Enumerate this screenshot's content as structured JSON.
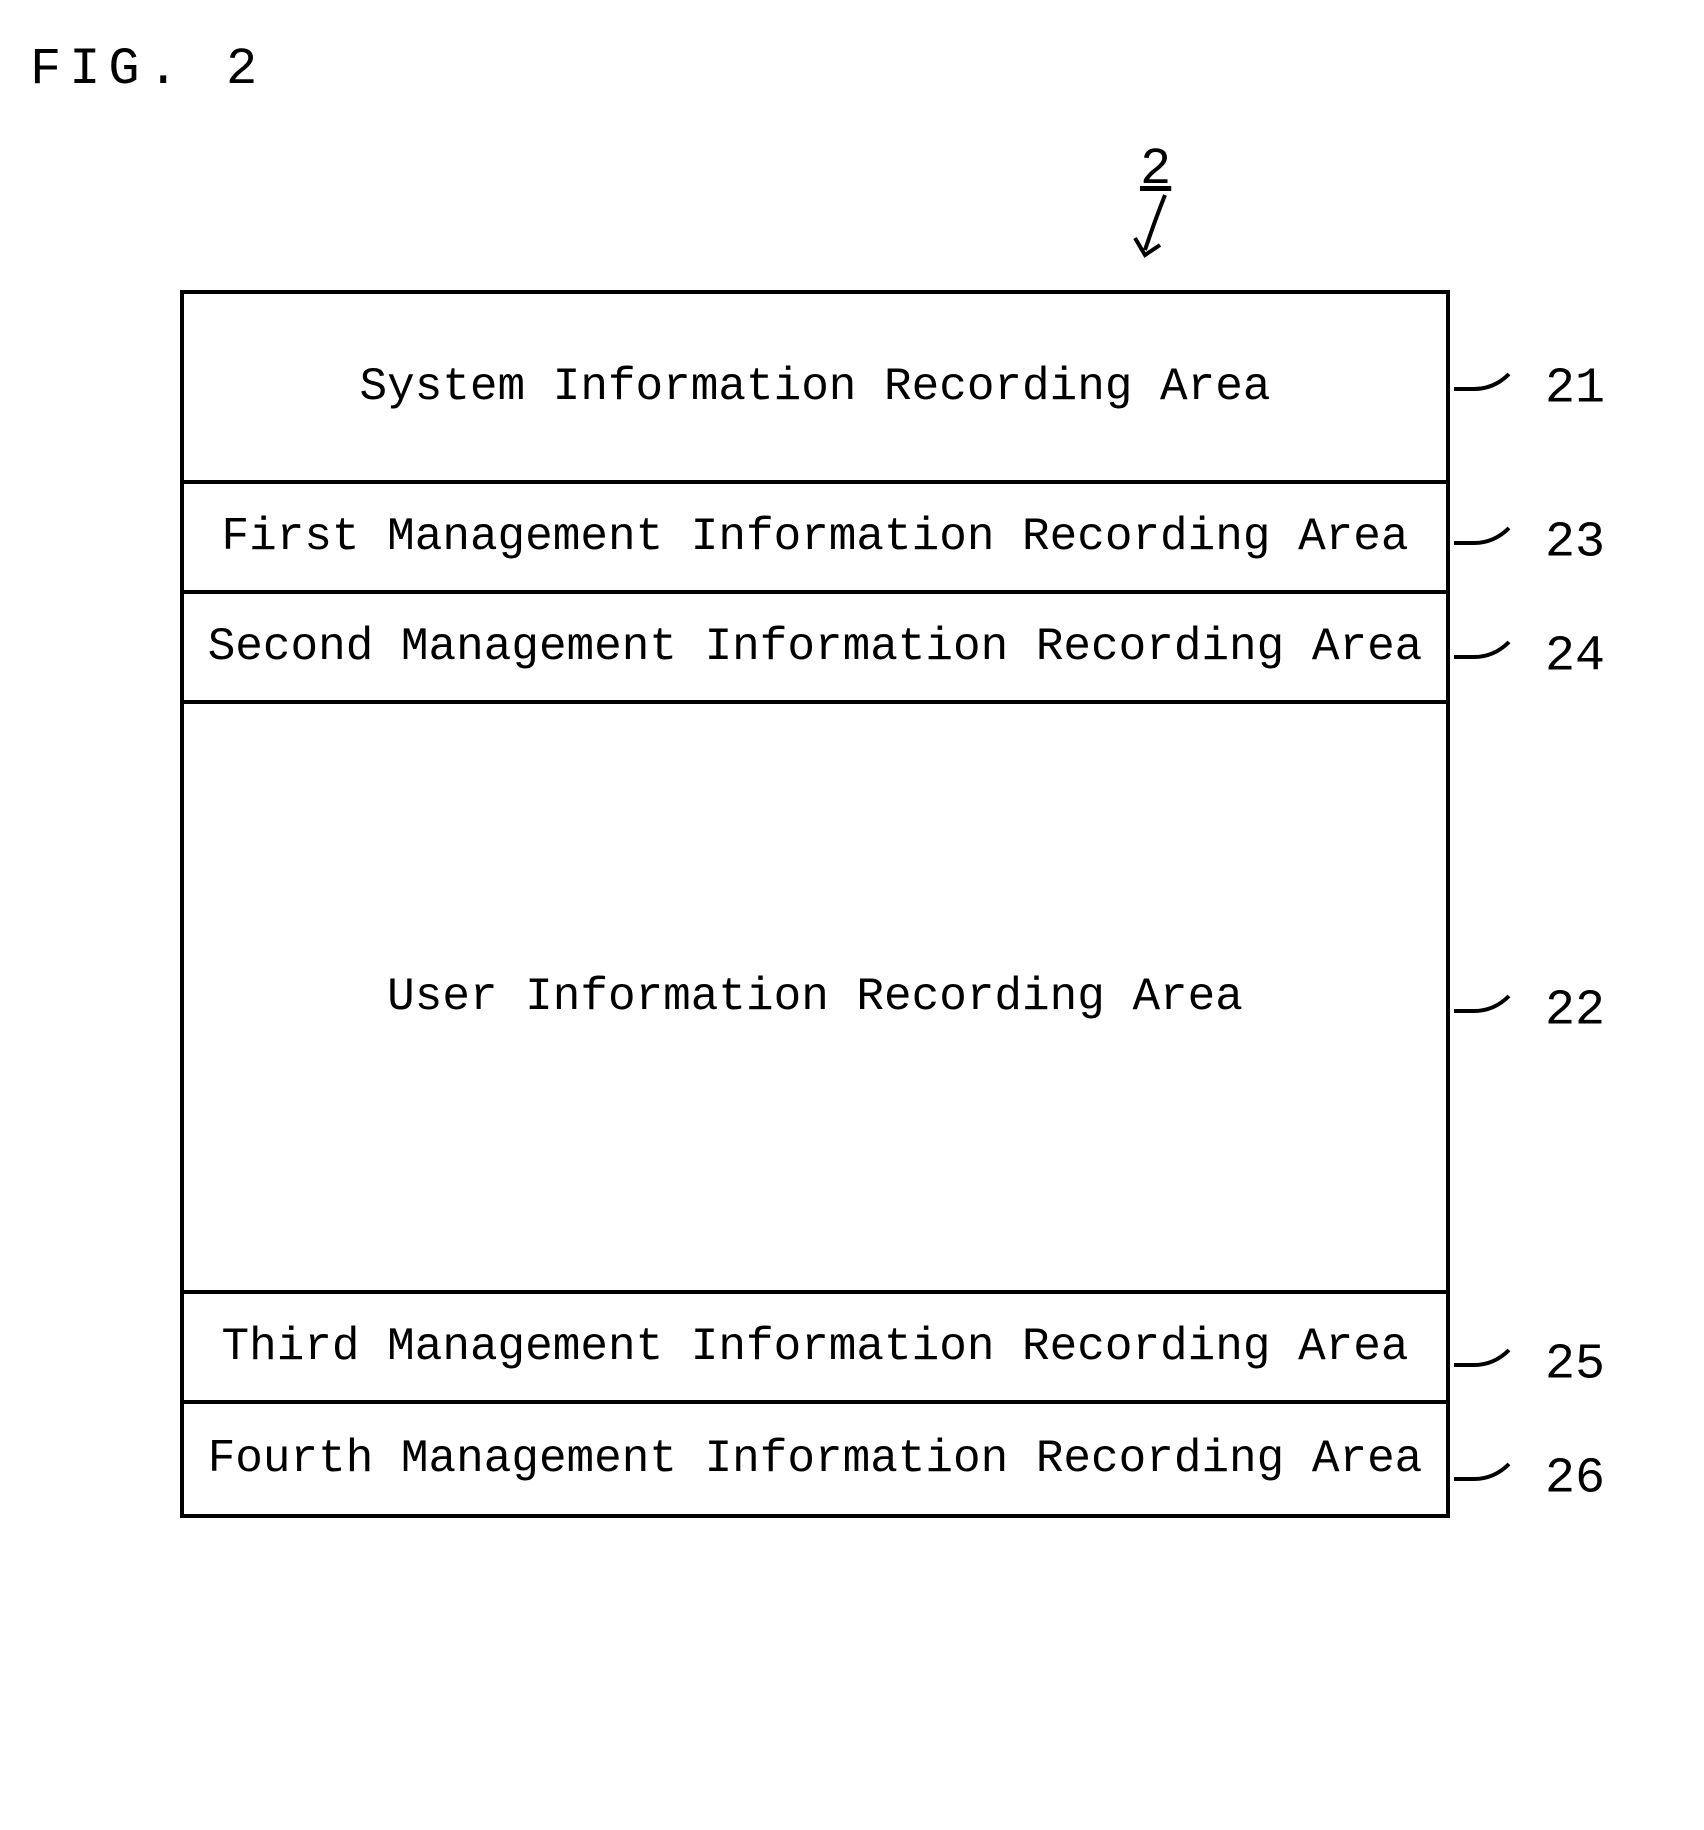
{
  "figure_label": "FIG. 2",
  "main_reference": "2",
  "rows": [
    {
      "label": "System Information Recording Area",
      "ref": "21",
      "size": "h-lg"
    },
    {
      "label": "First Management Information Recording Area",
      "ref": "23",
      "size": "h-sm"
    },
    {
      "label": "Second Management Information Recording Area",
      "ref": "24",
      "size": "h-sm"
    },
    {
      "label": "User Information Recording Area",
      "ref": "22",
      "size": "h-xl"
    },
    {
      "label": "Third Management Information Recording Area",
      "ref": "25",
      "size": "h-sm"
    },
    {
      "label": "Fourth Management Information Recording Area",
      "ref": "26",
      "size": "h-sm"
    }
  ]
}
